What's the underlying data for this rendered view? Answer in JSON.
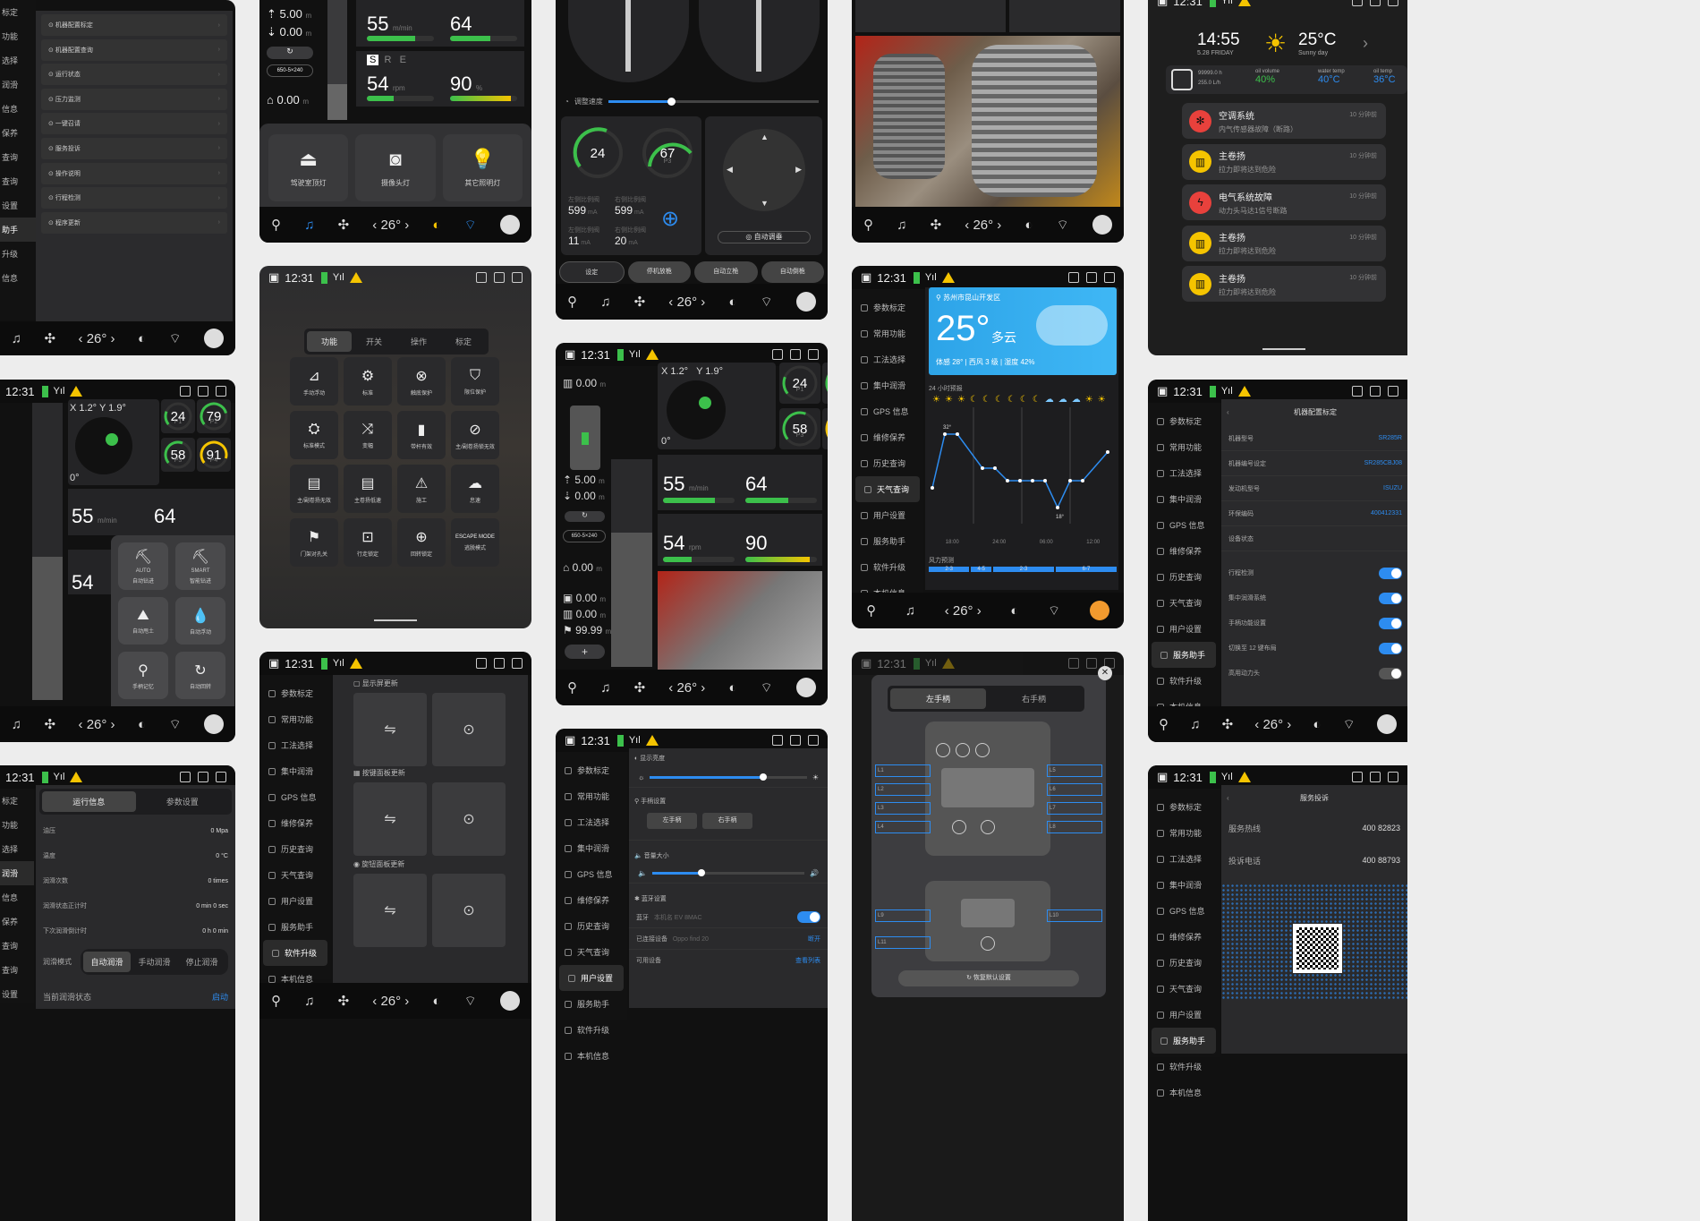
{
  "status": {
    "time": "12:31"
  },
  "dock": {
    "temp": "26°"
  },
  "sidebar_items": [
    "参数标定",
    "常用功能",
    "工法选择",
    "集中润滑",
    "GPS 信息",
    "维修保养",
    "历史查询",
    "天气查询",
    "用户设置",
    "服务助手",
    "软件升级",
    "本机信息"
  ],
  "left_menu": {
    "labels": [
      "标定",
      "功能",
      "选择",
      "润滑",
      "信息",
      "保养",
      "查询",
      "查询",
      "设置",
      "助手",
      "升级",
      "信息"
    ],
    "items": [
      "机器配置标定",
      "机器配置查询",
      "运行状态",
      "压力监测",
      "一键召请",
      "服务投诉",
      "操作说明",
      "行程检测",
      "程序更新"
    ]
  },
  "lighting": {
    "values": [
      "5.00",
      "0.00",
      "0.00"
    ],
    "preset": "650-5×240",
    "speed": {
      "value": "55",
      "unit": "m/min",
      "right": "64"
    },
    "rpm": {
      "gear": [
        "S",
        "R",
        "E"
      ],
      "value": "54",
      "unit": "rpm",
      "right": "90",
      "pct": "%"
    },
    "tiles": [
      "驾驶室顶灯",
      "摄像头灯",
      "其它照明灯"
    ]
  },
  "adjust": {
    "slider_label": "调整速度",
    "gauges": [
      {
        "v": "24"
      },
      {
        "v": "67",
        "s": "P3",
        "u": "Mpa"
      }
    ],
    "ma": [
      {
        "t": "左侧比例阀",
        "v": "599",
        "u": "mA"
      },
      {
        "t": "右侧比例阀",
        "v": "599",
        "u": "mA"
      },
      {
        "t": "左侧比例阀",
        "v": "11",
        "u": "mA"
      },
      {
        "t": "右侧比例阀",
        "v": "20",
        "u": "mA"
      }
    ],
    "auto_btn": "自动调垂",
    "bottom": [
      "设定",
      "停机放桅",
      "自动立桅",
      "自动倒桅"
    ]
  },
  "home": {
    "time": "14:55",
    "date": "5.28 FRIDAY",
    "temp": "25°C",
    "weather": "Sunny day",
    "stats": [
      {
        "k": "99999.0 h",
        "v": ""
      },
      {
        "k": "255.0 L/h",
        "v": ""
      },
      {
        "k": "oil volume",
        "v": "40%"
      },
      {
        "k": "water temp",
        "v": "40°C"
      },
      {
        "k": "oil temp",
        "v": "36°C"
      }
    ],
    "alerts": [
      {
        "t": "空调系统",
        "d": "内气传感器故障（断路）",
        "tm": "10 分钟前",
        "c": "#e8413c",
        "ic": "✻"
      },
      {
        "t": "主卷扬",
        "d": "拉力即将达到危险",
        "tm": "10 分钟前",
        "c": "#f5c400",
        "ic": "▥"
      },
      {
        "t": "电气系统故障",
        "d": "动力头马达1信号断路",
        "tm": "10 分钟前",
        "c": "#e8413c",
        "ic": "ϟ"
      },
      {
        "t": "主卷扬",
        "d": "拉力即将达到危险",
        "tm": "10 分钟前",
        "c": "#f5c400",
        "ic": "▥"
      },
      {
        "t": "主卷扬",
        "d": "拉力即将达到危险",
        "tm": "10 分钟前",
        "c": "#f5c400",
        "ic": "▥"
      }
    ]
  },
  "functions": {
    "tabs": [
      "功能",
      "开关",
      "操作",
      "标定"
    ],
    "tiles": [
      "手动浮动",
      "标准",
      "触底保护",
      "限位保护",
      "标准模式",
      "变幅",
      "带杆有效",
      "主/副卷扬锁无效",
      "主/副卷扬无效",
      "主卷扬低速",
      "施工",
      "怠速",
      "门架对孔关",
      "行走锁定",
      "回转锁定",
      "逃脱模式"
    ],
    "escape": "ESCAPE MODE"
  },
  "mast": {
    "x": "X 1.2°",
    "y": "Y 1.9°",
    "angle": "0°",
    "gauges": [
      {
        "v": "24",
        "s": "P1"
      },
      {
        "v": "79",
        "s": "P2"
      },
      {
        "v": "58",
        "s": "P3"
      },
      {
        "v": "91",
        "s": "P4"
      }
    ],
    "values": [
      "0.00",
      "5.00",
      "0.00",
      "0.00",
      "0.00",
      "0.00",
      "99.99"
    ],
    "preset": "650-5×240",
    "speed": {
      "value": "55",
      "unit": "m/min",
      "right": "64"
    },
    "rpm": {
      "value": "54",
      "unit": "rpm",
      "right": "90"
    }
  },
  "weather": {
    "location": "苏州市昆山开发区",
    "temp": "25°",
    "cond": "多云",
    "details": "体感 28°  |  西风 3 级  |  湿度 42%",
    "forecast_label": "24 小时预报",
    "times": [
      "18:00",
      "24:00",
      "06:00",
      "12:00"
    ],
    "hi": "32°",
    "lo": "18°",
    "wind_label": "风力预测",
    "wind": [
      "2-3",
      "4-5",
      "2-3",
      "6-7"
    ]
  },
  "config": {
    "title": "机器配置标定",
    "rows": [
      {
        "k": "机器型号",
        "v": "SR285R"
      },
      {
        "k": "机器编号设定",
        "v": "SR285CBJ08"
      },
      {
        "k": "发动机型号",
        "v": "ISUZU"
      },
      {
        "k": "环保编码",
        "v": "400412331"
      },
      {
        "k": "设备状态",
        "v": ""
      }
    ],
    "toggles": [
      "行程检测",
      "集中润滑系统",
      "手柄功能设置",
      "切换至 12 键布局",
      "高用动力头"
    ]
  },
  "auto": {
    "tiles": [
      "自动钻进",
      "智能钻进",
      "自动甩土",
      "自动浮动",
      "手柄记忆",
      "自动回转"
    ],
    "labels": [
      "AUTO",
      "SMART"
    ]
  },
  "lube": {
    "tabs": [
      "运行信息",
      "参数设置"
    ],
    "rows": [
      {
        "k": "油压",
        "v": "0 Mpa"
      },
      {
        "k": "温度",
        "v": "0 °C"
      },
      {
        "k": "润滑次数",
        "v": "0 times"
      },
      {
        "k": "润滑状态正计时",
        "v": "0 min 0 sec"
      },
      {
        "k": "下次润滑倒计时",
        "v": "0 h 0 min"
      }
    ],
    "mode_label": "润滑模式",
    "modes": [
      "自动润滑",
      "手动润滑",
      "停止润滑"
    ],
    "state_label": "当前润滑状态",
    "state": "启动"
  },
  "upgrade": {
    "sections": [
      "显示屏更新",
      "按键面板更新",
      "旋钮面板更新"
    ]
  },
  "settings": {
    "brightness": "显示亮度",
    "handle": "手柄设置",
    "left": "左手柄",
    "right": "右手柄",
    "volume": "音量大小",
    "bt": "蓝牙设置",
    "bt_label": "蓝牙",
    "bt_name": "本机名 EV 8MAC",
    "connected": "已连接设备",
    "device": "Oppo find 20",
    "disconnect": "断开",
    "available": "可用设备",
    "view": "查看列表"
  },
  "handle": {
    "tabs": [
      "左手柄",
      "右手柄"
    ],
    "reset": "恢复默认设置",
    "keys": [
      "L1",
      "L2",
      "L3",
      "L4",
      "L5",
      "L6",
      "L7",
      "L8",
      "L9",
      "L10",
      "L11"
    ]
  },
  "service": {
    "title": "服务投诉",
    "rows": [
      {
        "k": "服务热线",
        "v": "400 82823"
      },
      {
        "k": "投诉电话",
        "v": "400 88793"
      }
    ]
  }
}
